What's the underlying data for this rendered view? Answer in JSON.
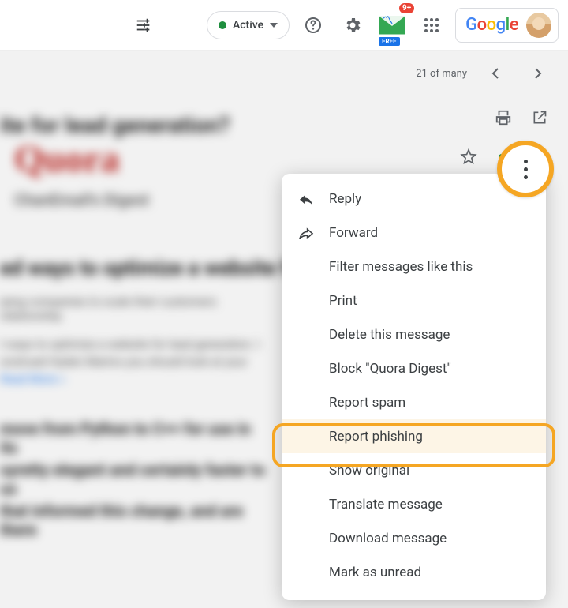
{
  "header": {
    "status_label": "Active",
    "mail_badge": "9+",
    "mail_free": "FREE",
    "google_logo": "Google"
  },
  "thread": {
    "position_text": "21 of many"
  },
  "background": {
    "quora_logo": "Quora",
    "digest_subtitle": "ChanEmail's Digest",
    "subject_blur": "ite for lead generation?",
    "h1": "ed ways to optimize a website for lead",
    "p1": "iping companies to scale their customers relationship",
    "p2a": "t ways to optimize a website for lead generation. I",
    "p2b": "onstrued Hyden Marino you should look at your",
    "read_more": "Read More »",
    "p3a": "move from Python to C++ for use in its",
    "p3b": "syretty elegant and certainly faster to us",
    "p3c": "that informed this change, and are there"
  },
  "menu": {
    "reply": "Reply",
    "forward": "Forward",
    "filter": "Filter messages like this",
    "print": "Print",
    "delete": "Delete this message",
    "block": "Block \"Quora Digest\"",
    "report_spam": "Report spam",
    "report_phishing": "Report phishing",
    "show_original": "Show original",
    "translate": "Translate message",
    "download": "Download message",
    "mark_unread": "Mark as unread"
  }
}
